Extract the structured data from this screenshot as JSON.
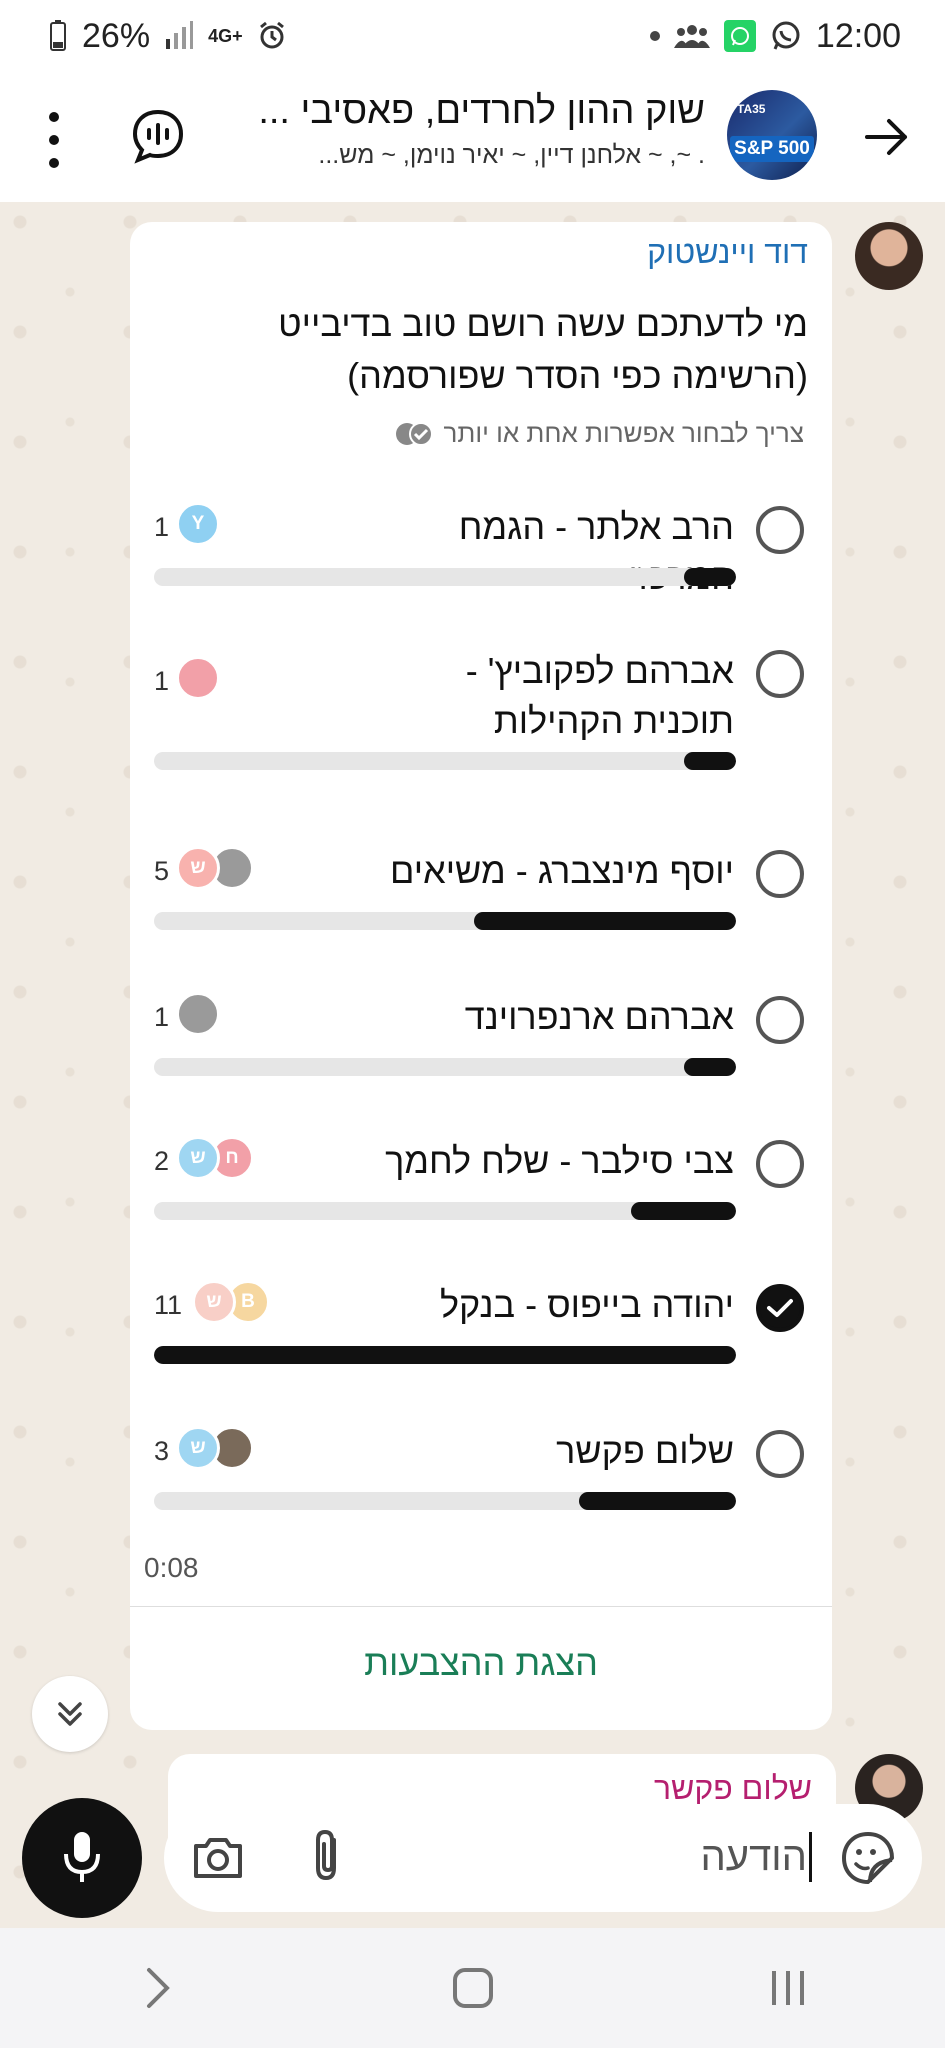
{
  "status_bar": {
    "battery": "26%",
    "network": "4G+",
    "time": "12:00"
  },
  "header": {
    "title": "שוק ההון לחרדים, פאסיבי ...",
    "subtitle": ". ~, ~ אלחנן דיין, ~ יאיר נוימן, ~ מש...",
    "avatar_badge": "S&P 500",
    "avatar_top": "TA35"
  },
  "poll_message": {
    "sender": "דוד ויינשטוק",
    "question": "מי לדעתכם עשה רושם טוב בדיבייט (הרשימה כפי הסדר שפורסמה)",
    "hint": "צריך לבחור אפשרות אחת או יותר",
    "time": "0:08",
    "view_votes_label": "הצגת ההצבעות",
    "options": [
      {
        "label": "הרב אלתר - הגמח המרכזי",
        "count": "1",
        "fraction": 0.09,
        "selected": false,
        "voters": [
          {
            "initial": "Y",
            "color": "#8fd0f2"
          }
        ]
      },
      {
        "label": "אברהם לפקוביץ' - תוכנית הקהילות",
        "count": "1",
        "fraction": 0.09,
        "selected": false,
        "voters": [
          {
            "initial": "",
            "color": "#f2a0a8"
          }
        ]
      },
      {
        "label": "יוסף מינצברג - משיאים",
        "count": "5",
        "fraction": 0.45,
        "selected": false,
        "voters": [
          {
            "initial": "ש",
            "color": "#f8b2ae"
          },
          {
            "initial": "",
            "color": "#9a9a9a"
          }
        ]
      },
      {
        "label": "אברהם ארנפרוינד",
        "count": "1",
        "fraction": 0.09,
        "selected": false,
        "voters": [
          {
            "initial": "",
            "color": "#9a9a9a"
          }
        ]
      },
      {
        "label": "צבי סילבר - שלח לחמך",
        "count": "2",
        "fraction": 0.18,
        "selected": false,
        "voters": [
          {
            "initial": "ש",
            "color": "#9fd6f2"
          },
          {
            "initial": "ח",
            "color": "#f2a0a8"
          }
        ]
      },
      {
        "label": "יהודה בייפוס - בנקל",
        "count": "11",
        "fraction": 1.0,
        "selected": true,
        "voters": [
          {
            "initial": "ש",
            "color": "#f8cfc7"
          },
          {
            "initial": "B",
            "color": "#f6d7a0"
          }
        ]
      },
      {
        "label": "שלום פקשר",
        "count": "3",
        "fraction": 0.27,
        "selected": false,
        "voters": [
          {
            "initial": "ש",
            "color": "#9fd6f2"
          },
          {
            "initial": "",
            "color": "#7a6a5a"
          }
        ]
      }
    ]
  },
  "next_message": {
    "sender": "שלום פקשר"
  },
  "composer": {
    "placeholder": "הודעה"
  }
}
